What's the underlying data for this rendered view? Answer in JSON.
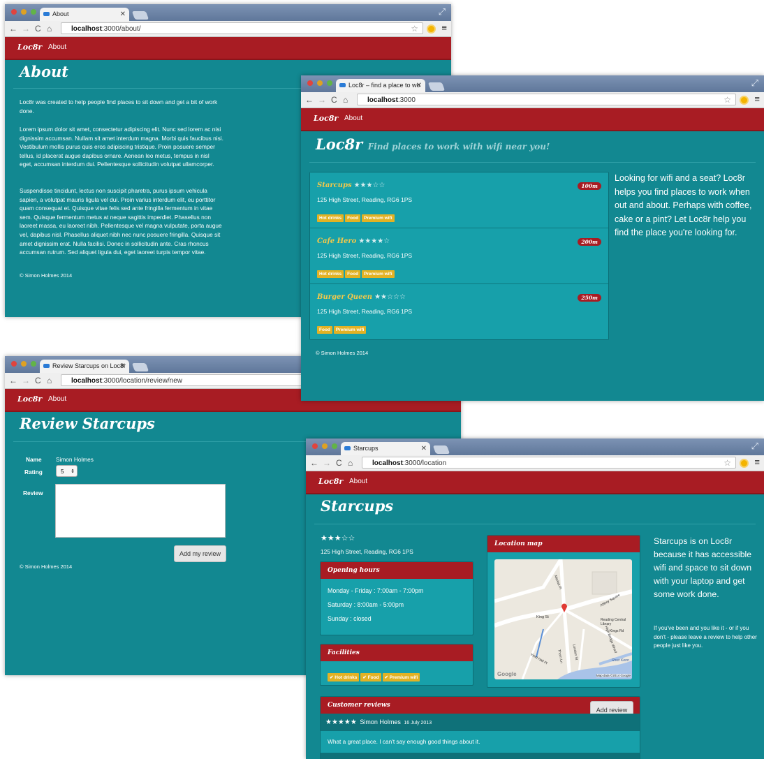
{
  "browser": {
    "new_tab_label": "",
    "window_controls": "⤢"
  },
  "brand": "Loc8r",
  "nav_about": "About",
  "about_window": {
    "tab_title": "About",
    "url_host": "localhost",
    "url_path": ":3000/about/",
    "heading": "About",
    "paragraphs": [
      "Loc8r was created to help people find places to sit down and get a bit of work done.",
      "Lorem ipsum dolor sit amet, consectetur adipiscing elit. Nunc sed lorem ac nisi dignissim accumsan. Nullam sit amet interdum magna. Morbi quis faucibus nisi. Vestibulum mollis purus quis eros adipiscing tristique. Proin posuere semper tellus, id placerat augue dapibus ornare. Aenean leo metus, tempus in nisl eget, accumsan interdum dui. Pellentesque sollicitudin volutpat ullamcorper.",
      "Suspendisse tincidunt, lectus non suscipit pharetra, purus ipsum vehicula sapien, a volutpat mauris ligula vel dui. Proin varius interdum elit, eu porttitor quam consequat et. Quisque vitae felis sed ante fringilla fermentum in vitae sem. Quisque fermentum metus at neque sagittis imperdiet. Phasellus non laoreet massa, eu laoreet nibh. Pellentesque vel magna vulputate, porta augue vel, dapibus nisl. Phasellus aliquet nibh nec nunc posuere fringilla. Quisque sit amet dignissim erat. Nulla facilisi. Donec in sollicitudin ante. Cras rhoncus accumsan rutrum. Sed aliquet ligula dui, eget laoreet turpis tempor vitae."
    ],
    "footer": "© Simon Holmes 2014"
  },
  "home_window": {
    "tab_title": "Loc8r – find a place to wo",
    "url_host": "localhost",
    "url_path": ":3000",
    "heading": "Loc8r",
    "tagline": "Find places to work with wifi near you!",
    "locations": [
      {
        "name": "Starcups",
        "rating": 3,
        "stars": "★★★☆☆",
        "distance": "100m",
        "address": "125 High Street, Reading, RG6 1PS",
        "facilities": [
          "Hot drinks",
          "Food",
          "Premium wifi"
        ]
      },
      {
        "name": "Cafe Hero",
        "rating": 4,
        "stars": "★★★★☆",
        "distance": "200m",
        "address": "125 High Street, Reading, RG6 1PS",
        "facilities": [
          "Hot drinks",
          "Food",
          "Premium wifi"
        ]
      },
      {
        "name": "Burger Queen",
        "rating": 2,
        "stars": "★★☆☆☆",
        "distance": "250m",
        "address": "125 High Street, Reading, RG6 1PS",
        "facilities": [
          "Food",
          "Premium wifi"
        ]
      }
    ],
    "sidebar": "Looking for wifi and a seat? Loc8r helps you find places to work when out and about. Perhaps with coffee, cake or a pint? Let Loc8r help you find the place you're looking for.",
    "footer": "© Simon Holmes 2014"
  },
  "review_window": {
    "tab_title": "Review Starcups on Loc8r",
    "url_host": "localhost",
    "url_path": ":3000/location/review/new",
    "heading": "Review Starcups",
    "name_label": "Name",
    "name_value": "Simon Holmes",
    "rating_label": "Rating",
    "rating_value": "5",
    "review_label": "Review",
    "review_value": "",
    "submit_label": "Add my review",
    "footer": "© Simon Holmes 2014"
  },
  "location_window": {
    "tab_title": "Starcups",
    "url_host": "localhost",
    "url_path": ":3000/location",
    "heading": "Starcups",
    "rating": 3,
    "stars": "★★★☆☆",
    "address": "125 High Street, Reading, RG6 1PS",
    "opening_hours_title": "Opening hours",
    "opening_hours": [
      "Monday - Friday : 7:00am - 7:00pm",
      "Saturday : 8:00am - 5:00pm",
      "Sunday : closed"
    ],
    "facilities_title": "Facilities",
    "facilities": [
      "✔ Hot drinks",
      "✔ Food",
      "✔ Premium wifi"
    ],
    "map_title": "Location map",
    "map_labels": {
      "kings_rd": "Kings Rd",
      "king_st": "King St",
      "abbey_square": "Abbey Square",
      "library": "Reading Central Library",
      "river": "River Kenn",
      "google": "Google",
      "map_data": "Map data ©2014 Google",
      "market_pl": "Market Pl",
      "yield_hall": "Yield Hall Pl",
      "thorn_ln": "Thorn Ln",
      "london_st": "London St",
      "high_bridge": "High Bridge Wharf"
    },
    "sidebar_main": "Starcups is on Loc8r because it has accessible wifi and space to sit down with your laptop and get some work done.",
    "sidebar_small": "If you've been and you like it - or if you don't - please leave a review to help other people just like you.",
    "reviews_title": "Customer reviews",
    "add_review_label": "Add review",
    "review": {
      "stars": "★★★★★",
      "author": "Simon Holmes",
      "date": "16 July 2013",
      "text": "What a great place. I can't say enough good things about it."
    }
  }
}
